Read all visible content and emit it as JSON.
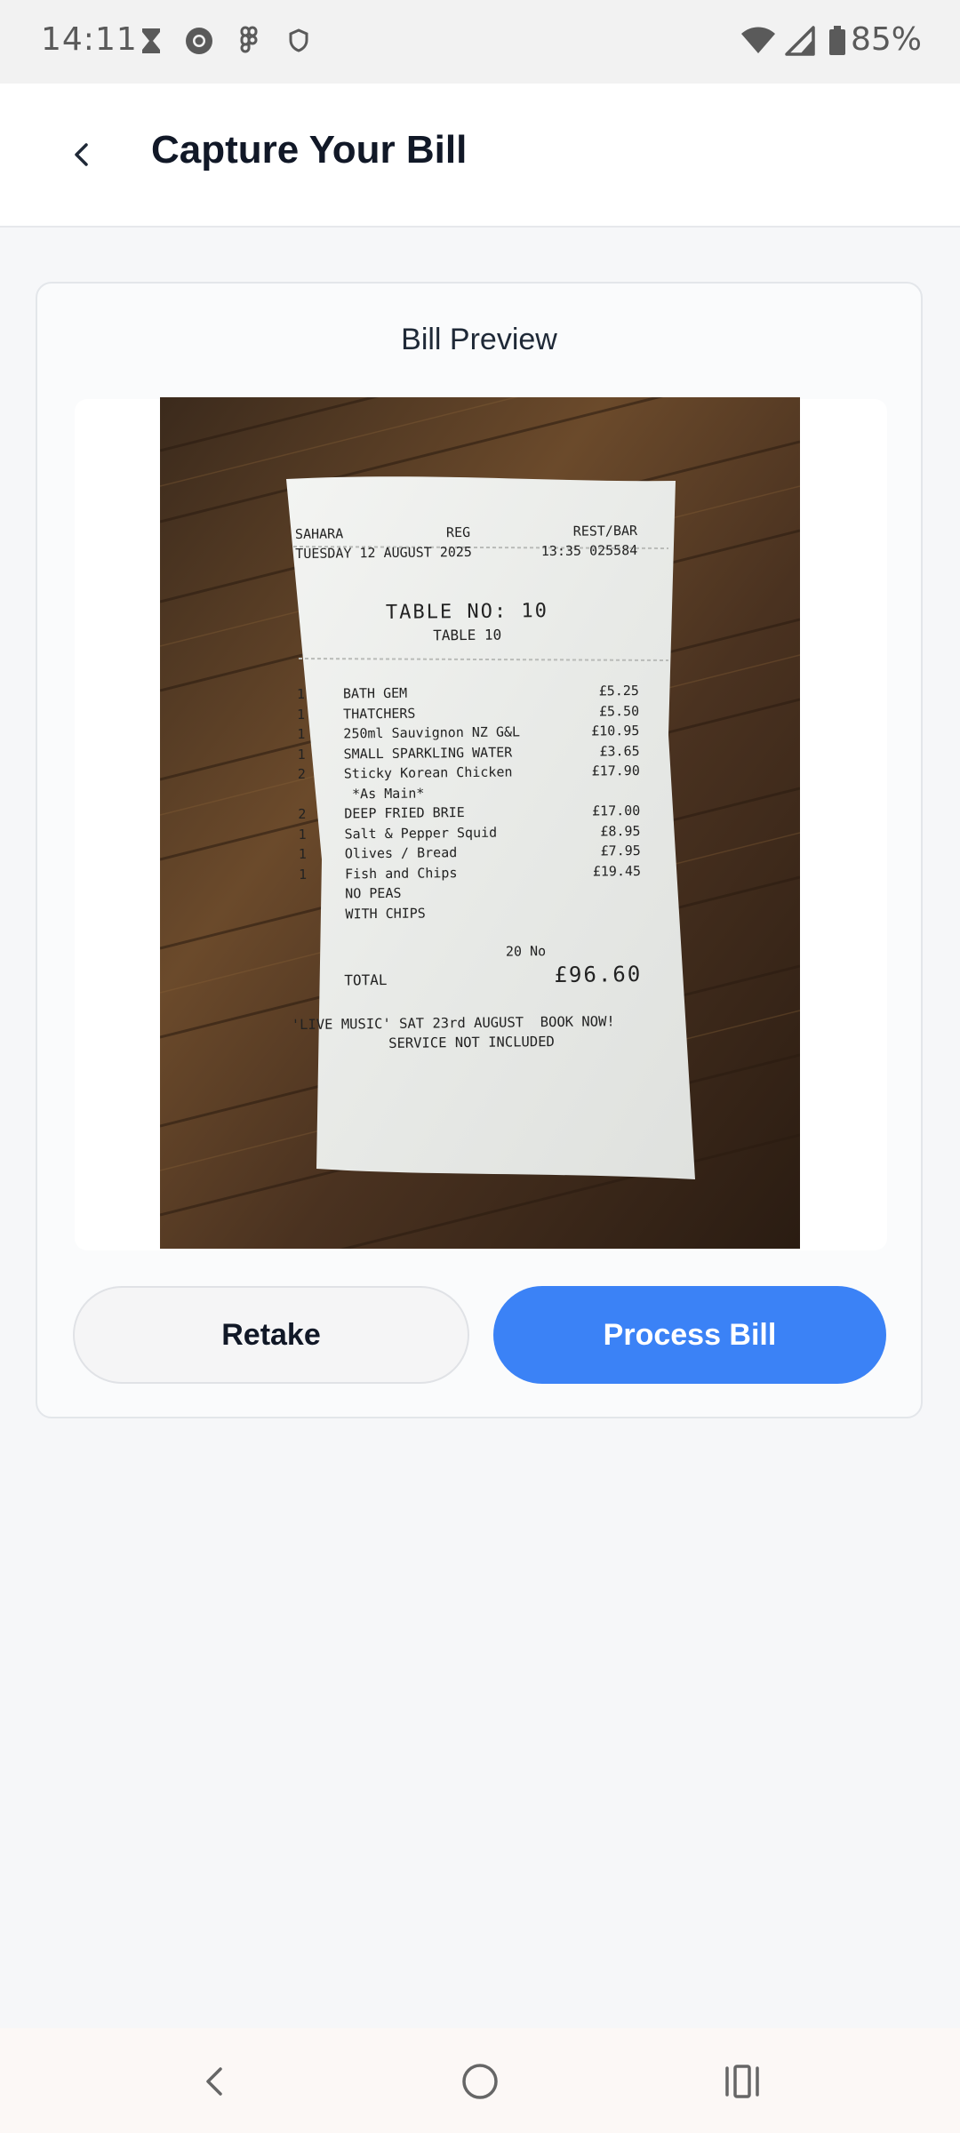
{
  "status_bar": {
    "time": "14:11",
    "battery": "85%",
    "icons": [
      "hourglass-icon",
      "chrome-icon",
      "figma-icon",
      "shield-icon",
      "wifi-icon",
      "signal-icon",
      "battery-icon"
    ]
  },
  "header": {
    "title": "Capture Your Bill",
    "back_icon": "chevron-left-icon"
  },
  "card": {
    "title": "Bill Preview",
    "retake_label": "Retake",
    "process_label": "Process Bill"
  },
  "receipt": {
    "venue": "SAHARA",
    "reg": "REG",
    "dept": "REST/BAR",
    "date": "TUESDAY 12 AUGUST 2025",
    "time_code": "13:35 025584",
    "table_header": "TABLE NO:  10",
    "table_sub": "TABLE 10",
    "items": [
      {
        "qty": "1",
        "name": "BATH GEM",
        "price": "£5.25"
      },
      {
        "qty": "1",
        "name": "THATCHERS",
        "price": "£5.50"
      },
      {
        "qty": "1",
        "name": "250ml Sauvignon NZ G&L",
        "price": "£10.95"
      },
      {
        "qty": "1",
        "name": "SMALL SPARKLING WATER",
        "price": "£3.65"
      },
      {
        "qty": "2",
        "name": "Sticky Korean Chicken",
        "price": "£17.90"
      },
      {
        "qty": "",
        "name": " *As Main*",
        "price": ""
      },
      {
        "qty": "2",
        "name": "DEEP FRIED BRIE",
        "price": "£17.00"
      },
      {
        "qty": "1",
        "name": "Salt & Pepper Squid",
        "price": "£8.95"
      },
      {
        "qty": "1",
        "name": "Olives / Bread",
        "price": "£7.95"
      },
      {
        "qty": "1",
        "name": "Fish and Chips",
        "price": "£19.45"
      },
      {
        "qty": "",
        "name": "NO PEAS",
        "price": ""
      },
      {
        "qty": "",
        "name": "WITH CHIPS",
        "price": ""
      }
    ],
    "count": "20 No",
    "total_label": "TOTAL",
    "total": "£96.60",
    "footer_1": "'LIVE MUSIC' SAT 23rd AUGUST  BOOK NOW!",
    "footer_2": "SERVICE NOT INCLUDED"
  },
  "nav_bar": {
    "icons": [
      "nav-back-icon",
      "nav-home-icon",
      "nav-recents-icon"
    ]
  },
  "colors": {
    "accent": "#3b82f6",
    "title_text": "#111827",
    "background": "#f6f7f9"
  }
}
